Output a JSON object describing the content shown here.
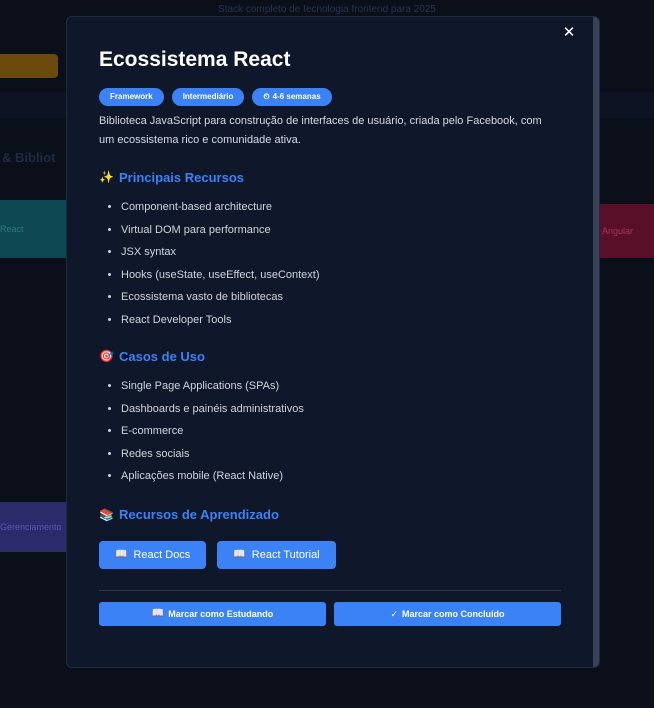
{
  "background": {
    "subtitle": "Stack completo de tecnologia frontend para 2025",
    "heading": "& Bibliot",
    "teal_card": "React",
    "red_card": "Angular",
    "indigo_card": "Gerenciamento"
  },
  "modal": {
    "close_label": "✕",
    "title": "Ecossistema React",
    "badges": [
      {
        "label": "Framework"
      },
      {
        "label": "Intermediário"
      },
      {
        "label": "4-6 semanas",
        "icon": "clock-icon"
      }
    ],
    "description": "Biblioteca JavaScript para construção de interfaces de usuário, criada pelo Facebook, com um ecossistema rico e comunidade ativa.",
    "features": {
      "icon": "sparkles-icon",
      "title": "Principais Recursos",
      "items": [
        "Component-based architecture",
        "Virtual DOM para performance",
        "JSX syntax",
        "Hooks (useState, useEffect, useContext)",
        "Ecossistema vasto de bibliotecas",
        "React Developer Tools"
      ]
    },
    "use_cases": {
      "icon": "target-icon",
      "title": "Casos de Uso",
      "items": [
        "Single Page Applications (SPAs)",
        "Dashboards e painéis administrativos",
        "E-commerce",
        "Redes sociais",
        "Aplicações mobile (React Native)"
      ]
    },
    "resources": {
      "icon": "books-icon",
      "title": "Recursos de Aprendizado",
      "buttons": [
        {
          "label": "React Docs",
          "icon": "book-icon"
        },
        {
          "label": "React Tutorial",
          "icon": "book-icon"
        }
      ]
    },
    "actions": {
      "studying_label": "Marcar como Estudando",
      "completed_label": "Marcar como Concluído"
    }
  },
  "colors": {
    "accent": "#3b82f6",
    "modal_bg": "#0f172a",
    "page_bg": "#0b0f1a"
  }
}
